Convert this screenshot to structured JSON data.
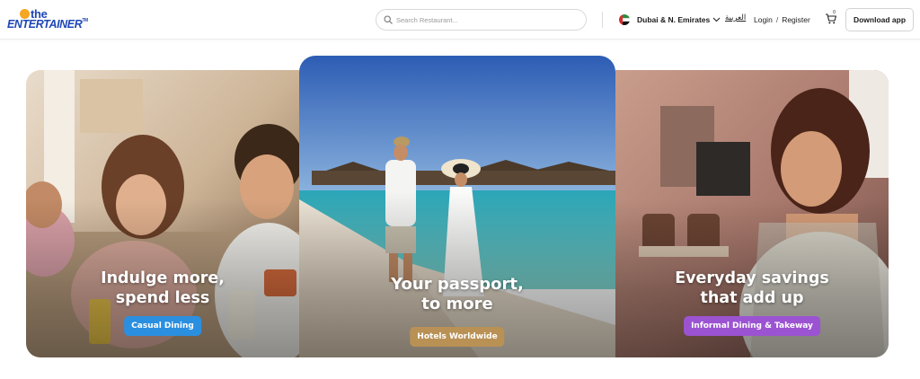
{
  "header": {
    "logo": {
      "small": "the",
      "main": "ENTERTAINER",
      "tm": "TM"
    },
    "search": {
      "placeholder": "Search Restaurant..."
    },
    "region": {
      "label": "Dubai & N. Emirates"
    },
    "language": {
      "label": "العربية"
    },
    "auth": {
      "login": "Login",
      "separator": "/",
      "register": "Register"
    },
    "cart": {
      "count": "0"
    },
    "download_button": "Download app"
  },
  "cards": [
    {
      "headline_line1": "Indulge more,",
      "headline_line2": "spend less",
      "tag": "Casual Dining",
      "tag_color": "#2b8fe0"
    },
    {
      "headline_line1": "Your passport,",
      "headline_line2": "to more",
      "tag": "Hotels Worldwide",
      "tag_color": "#b99155"
    },
    {
      "headline_line1": "Everyday savings",
      "headline_line2": "that add up",
      "tag": "Informal Dining & Takeway",
      "tag_color": "#9b53d2"
    }
  ],
  "colors": {
    "brand_blue": "#1f47b6",
    "brand_orange": "#f5a623"
  },
  "icons": [
    "search-icon",
    "uae-flag-icon",
    "chevron-down-icon",
    "cart-icon"
  ]
}
